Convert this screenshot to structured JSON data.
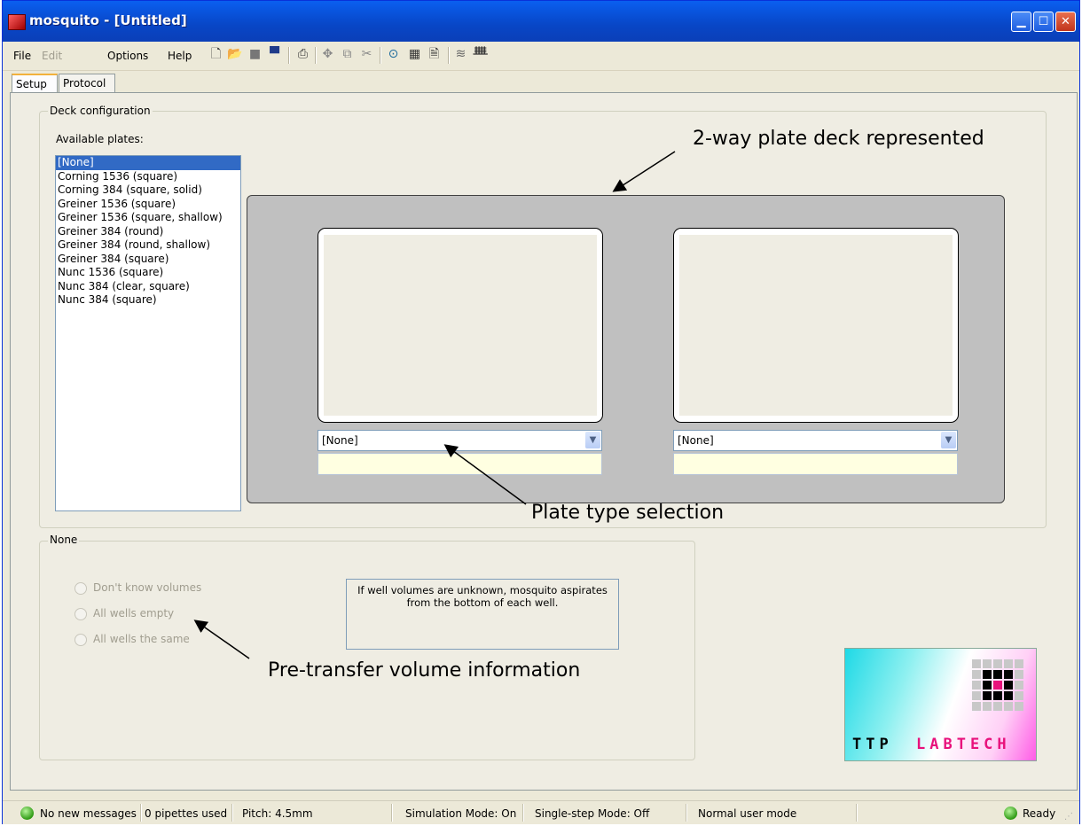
{
  "window": {
    "title": "mosquito - [Untitled]"
  },
  "menu": {
    "file": "File",
    "edit": "Edit",
    "options": "Options",
    "help": "Help"
  },
  "toolbar": {
    "icons": [
      "new-file-icon",
      "open-folder-icon",
      "save-icon",
      "save-as-icon",
      "print-icon",
      "move-icon",
      "copy-icon",
      "cut-icon",
      "aspirate-icon",
      "plate-grid-icon",
      "report-icon",
      "wash-icon",
      "pipette-rack-icon"
    ]
  },
  "tabs": [
    "Setup",
    "Protocol"
  ],
  "deck": {
    "group_label": "Deck configuration",
    "available_label": "Available plates:",
    "plates": [
      "[None]",
      "Corning 1536 (square)",
      "Corning 384 (square, solid)",
      "Greiner 1536 (square)",
      "Greiner 1536 (square, shallow)",
      "Greiner 384 (round)",
      "Greiner 384 (round, shallow)",
      "Greiner 384 (square)",
      "Nunc 1536 (square)",
      "Nunc 384 (clear, square)",
      "Nunc 384 (square)"
    ],
    "selected_index": 0,
    "position1": {
      "plate_type": "[None]",
      "info": ""
    },
    "position2": {
      "plate_type": "[None]",
      "info": ""
    }
  },
  "volumes": {
    "group_label": "None",
    "options": [
      "Don't know volumes",
      "All wells empty",
      "All wells the same"
    ],
    "info_text": "If well volumes are unknown, mosquito aspirates from the bottom of each well."
  },
  "annotations": {
    "deck": "2-way plate deck represented",
    "plate_type": "Plate type selection",
    "volume": "Pre-transfer volume information"
  },
  "logo": {
    "text": "TTP  LABTECH",
    "ttp": "TTP",
    "labtech": "LABTECH"
  },
  "status": {
    "messages": "No new messages",
    "pipettes": "0 pipettes used",
    "pitch": "Pitch: 4.5mm",
    "simulation": "Simulation Mode: On",
    "single_step": "Single-step Mode: Off",
    "user_mode": "Normal user mode",
    "ready": "Ready"
  },
  "colors": {
    "accent": "#316ac5",
    "titlebar": "#0846c6",
    "deck": "#c0c0c0",
    "logo_magenta": "#e8127c"
  }
}
